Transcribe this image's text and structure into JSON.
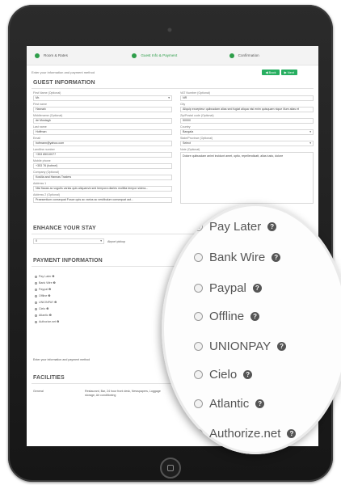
{
  "steps": [
    {
      "label": "Room & Rates"
    },
    {
      "label": "Guest Info & Payment"
    },
    {
      "label": "Confirmation"
    }
  ],
  "hint_text": "Enter your information and payment method",
  "nav": {
    "back": "◀ Back",
    "next": "▶ Next"
  },
  "guest_section": {
    "title": "GUEST INFORMATION",
    "left_fields": [
      {
        "label": "First Name (Optional)",
        "value": "Mr."
      },
      {
        "label": "First name",
        "value": "Hannah"
      },
      {
        "label": "Middlename (Optional)",
        "value": "de Mustagh"
      },
      {
        "label": "Last name",
        "value": "Hoffman"
      },
      {
        "label": "Email",
        "value": "hofmann@yahoo.com"
      },
      {
        "label": "Landline number",
        "value": "+353 85010077"
      },
      {
        "label": "Mobile phone",
        "value": "+353 76 (hofmel)"
      },
      {
        "label": "Company (Optional)",
        "value": "Kosilla and Hannas Traders"
      },
      {
        "label": "Address 1",
        "value": "Nisl fiaoas ac vogutis varias quis aliquam/a sed tempora diaries mollitia tempor sidera..."
      },
      {
        "label": "Address 2 (Optional)",
        "value": "Praesentium consequat Fusce quis ac varius ac vestibulum consequat aut..."
      }
    ],
    "right_fields": [
      {
        "label": "VAT Number (Optional)",
        "value": "NR"
      },
      {
        "label": "City",
        "value": "Aliquip excepteur quibusdam alias sed fugiat aliqua nisi enim quisquam nique illum alias et"
      },
      {
        "label": "Zip/Postal code (Optional)",
        "value": "50000"
      },
      {
        "label": "Country",
        "value": "Bangala"
      },
      {
        "label": "State/Province (Optional)",
        "value": "Select"
      },
      {
        "label": "Note (Optional)",
        "value": "Dolore quibusdam animi incidunt amet, optio, repellendicatt, alias iusto, dolore"
      }
    ]
  },
  "stay_section": {
    "title": "ENHANCE YOUR STAY",
    "select_value": "0",
    "select_hint": "Airport pickup"
  },
  "payment_section": {
    "title": "PAYMENT INFORMATION",
    "small_options": [
      "Pay Later ❷",
      "Bank Wire ❷",
      "Paypal ❷",
      "Offline ❷",
      "UNIONPAY ❷",
      "Cielo ❷",
      "Atlantic ❷",
      "Authorize.net ❷"
    ],
    "footer_hint": "Enter your information and payment method"
  },
  "facilities_section": {
    "title": "FACILITIES",
    "row_label": "General",
    "row_value": "Restaurant, Bar, 24 hour front desk, Newspapers, Luggage storage, Air conditioning"
  },
  "magnified_options": [
    {
      "label": "Pay Later",
      "checked": true
    },
    {
      "label": "Bank Wire",
      "checked": false
    },
    {
      "label": "Paypal",
      "checked": false
    },
    {
      "label": "Offline",
      "checked": false
    },
    {
      "label": "UNIONPAY",
      "checked": false
    },
    {
      "label": "Cielo",
      "checked": false
    },
    {
      "label": "Atlantic",
      "checked": false
    },
    {
      "label": "Authorize.net",
      "checked": false
    }
  ],
  "colors": {
    "accent": "#27ae60",
    "frame": "#1e1e1e"
  }
}
